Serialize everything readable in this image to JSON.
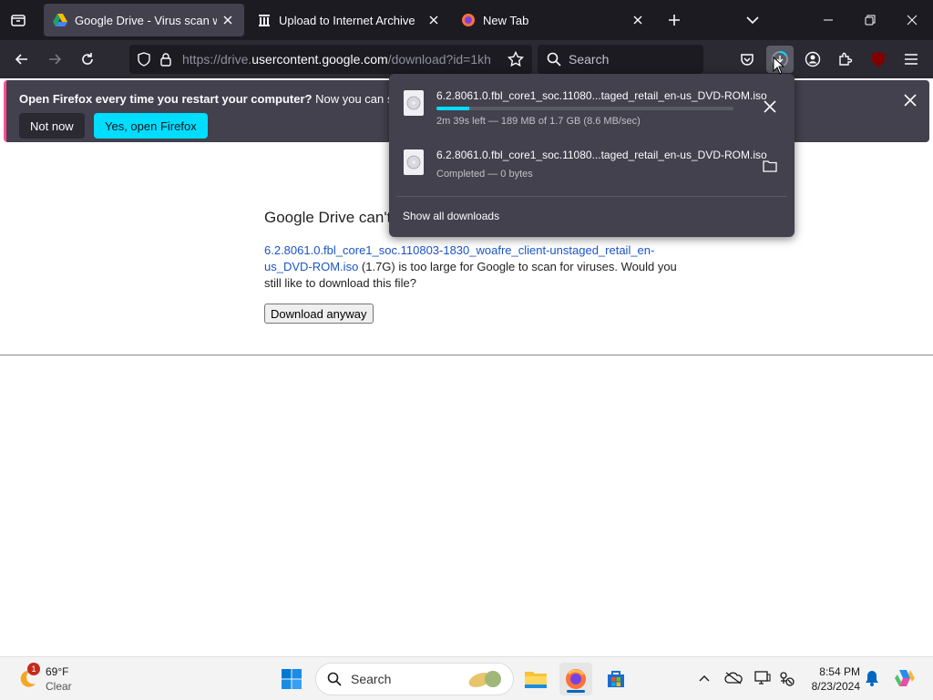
{
  "window": {
    "tabs": [
      {
        "title": "Google Drive - Virus scan warning",
        "active": true,
        "icon": "google-drive-icon"
      },
      {
        "title": "Upload to Internet Archive",
        "active": false,
        "icon": "archive-icon"
      },
      {
        "title": "New Tab",
        "active": false,
        "icon": "firefox-icon"
      }
    ]
  },
  "navbar": {
    "url_prefix": "https://drive.",
    "url_host": "usercontent.google.com",
    "url_path": "/download?id=1kh",
    "search_placeholder": "Search"
  },
  "notification": {
    "bold": "Open Firefox every time you restart your computer?",
    "text": " Now you can set Firefox to open automatically after a restart.",
    "not_now": "Not now",
    "open": "Yes, open Firefox"
  },
  "page": {
    "title": "Google Drive can't scan this file for viruses.",
    "file_link": "6.2.8061.0.fbl_core1_soc.110803-1830_woafre_client-unstaged_retail_en-us_DVD-ROM.iso",
    "message_after": " (1.7G) is too large for Google to scan for viruses. Would you still like to download this file?",
    "download_button": "Download anyway"
  },
  "downloads": {
    "items": [
      {
        "name": "6.2.8061.0.fbl_core1_soc.11080...taged_retail_en-us_DVD-ROM.iso",
        "status": "2m 39s left — 189 MB of 1.7 GB (8.6 MB/sec)",
        "progress": 0.11,
        "action": "cancel"
      },
      {
        "name": "6.2.8061.0.fbl_core1_soc.11080...taged_retail_en-us_DVD-ROM.iso",
        "status": "Completed — 0 bytes",
        "action": "show-in-folder"
      }
    ],
    "show_all": "Show all downloads"
  },
  "taskbar": {
    "weather_temp": "69°F",
    "weather_cond": "Clear",
    "weather_badge": "1",
    "search_label": "Search",
    "time": "8:54 PM",
    "date": "8/23/2024"
  },
  "colors": {
    "accent": "#00ddff",
    "notif_stripe": "#ff4f9a",
    "link": "#1a55c6"
  }
}
